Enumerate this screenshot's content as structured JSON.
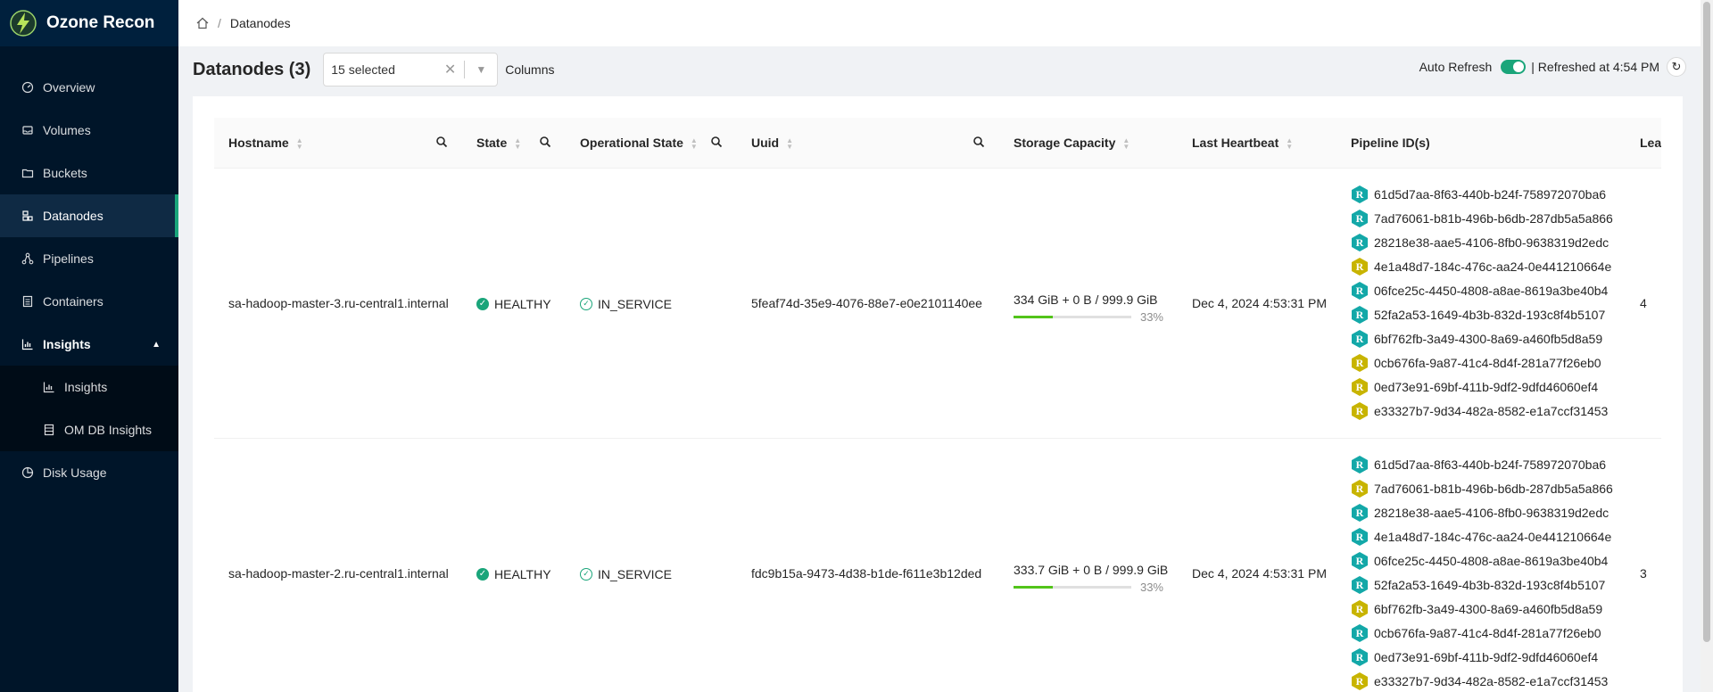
{
  "app": {
    "title": "Ozone Recon"
  },
  "sidebar": {
    "items": [
      {
        "label": "Overview",
        "icon": "dashboard-icon"
      },
      {
        "label": "Volumes",
        "icon": "inbox-icon"
      },
      {
        "label": "Buckets",
        "icon": "folder-icon"
      },
      {
        "label": "Datanodes",
        "icon": "cluster-icon",
        "active": true
      },
      {
        "label": "Pipelines",
        "icon": "deployment-icon"
      },
      {
        "label": "Containers",
        "icon": "container-icon"
      },
      {
        "label": "Insights",
        "icon": "bar-chart-icon",
        "open": true
      },
      {
        "label": "Disk Usage",
        "icon": "pie-chart-icon"
      }
    ],
    "insights_sub": [
      {
        "label": "Insights",
        "icon": "bar-chart-icon"
      },
      {
        "label": "OM DB Insights",
        "icon": "database-icon"
      }
    ]
  },
  "breadcrumb": {
    "current": "Datanodes"
  },
  "page": {
    "title": "Datanodes (3)",
    "column_select_value": "15 selected",
    "columns_label": "Columns",
    "auto_refresh_label": "Auto Refresh",
    "refreshed_text": "| Refreshed at 4:54 PM"
  },
  "table": {
    "headers": {
      "hostname": "Hostname",
      "state": "State",
      "op_state": "Operational State",
      "uuid": "Uuid",
      "capacity": "Storage Capacity",
      "heartbeat": "Last Heartbeat",
      "pipelines": "Pipeline ID(s)",
      "leader": "Leader Count"
    },
    "rows": [
      {
        "hostname": "sa-hadoop-master-3.ru-central1.internal",
        "state": "HEALTHY",
        "op_state": "IN_SERVICE",
        "uuid": "5feaf74d-35e9-4076-88e7-e0e2101140ee",
        "capacity": "334 GiB + 0 B / 999.9 GiB",
        "capacity_pct": "33%",
        "capacity_fill": 0.33,
        "heartbeat": "Dec 4, 2024 4:53:31 PM",
        "pipelines": [
          {
            "id": "61d5d7aa-8f63-440b-b24f-758972070ba6",
            "leader": false
          },
          {
            "id": "7ad76061-b81b-496b-b6db-287db5a5a866",
            "leader": false
          },
          {
            "id": "28218e38-aae5-4106-8fb0-9638319d2edc",
            "leader": false
          },
          {
            "id": "4e1a48d7-184c-476c-aa24-0e441210664e",
            "leader": true
          },
          {
            "id": "06fce25c-4450-4808-a8ae-8619a3be40b4",
            "leader": false
          },
          {
            "id": "52fa2a53-1649-4b3b-832d-193c8f4b5107",
            "leader": false
          },
          {
            "id": "6bf762fb-3a49-4300-8a69-a460fb5d8a59",
            "leader": false
          },
          {
            "id": "0cb676fa-9a87-41c4-8d4f-281a77f26eb0",
            "leader": true
          },
          {
            "id": "0ed73e91-69bf-411b-9df2-9dfd46060ef4",
            "leader": true
          },
          {
            "id": "e33327b7-9d34-482a-8582-e1a7ccf31453",
            "leader": true
          }
        ],
        "leader_count": "4"
      },
      {
        "hostname": "sa-hadoop-master-2.ru-central1.internal",
        "state": "HEALTHY",
        "op_state": "IN_SERVICE",
        "uuid": "fdc9b15a-9473-4d38-b1de-f611e3b12ded",
        "capacity": "333.7 GiB + 0 B / 999.9 GiB",
        "capacity_pct": "33%",
        "capacity_fill": 0.33,
        "heartbeat": "Dec 4, 2024 4:53:31 PM",
        "pipelines": [
          {
            "id": "61d5d7aa-8f63-440b-b24f-758972070ba6",
            "leader": false
          },
          {
            "id": "7ad76061-b81b-496b-b6db-287db5a5a866",
            "leader": true
          },
          {
            "id": "28218e38-aae5-4106-8fb0-9638319d2edc",
            "leader": false
          },
          {
            "id": "4e1a48d7-184c-476c-aa24-0e441210664e",
            "leader": false
          },
          {
            "id": "06fce25c-4450-4808-a8ae-8619a3be40b4",
            "leader": false
          },
          {
            "id": "52fa2a53-1649-4b3b-832d-193c8f4b5107",
            "leader": false
          },
          {
            "id": "6bf762fb-3a49-4300-8a69-a460fb5d8a59",
            "leader": true
          },
          {
            "id": "0cb676fa-9a87-41c4-8d4f-281a77f26eb0",
            "leader": false
          },
          {
            "id": "0ed73e91-69bf-411b-9df2-9dfd46060ef4",
            "leader": false
          },
          {
            "id": "e33327b7-9d34-482a-8582-e1a7ccf31453",
            "leader": true
          }
        ],
        "leader_count": "3"
      }
    ]
  },
  "colors": {
    "accent": "#1aa57a",
    "sidebar": "#001529",
    "hex_default": "#13a8a8",
    "hex_leader": "#c8b400"
  }
}
